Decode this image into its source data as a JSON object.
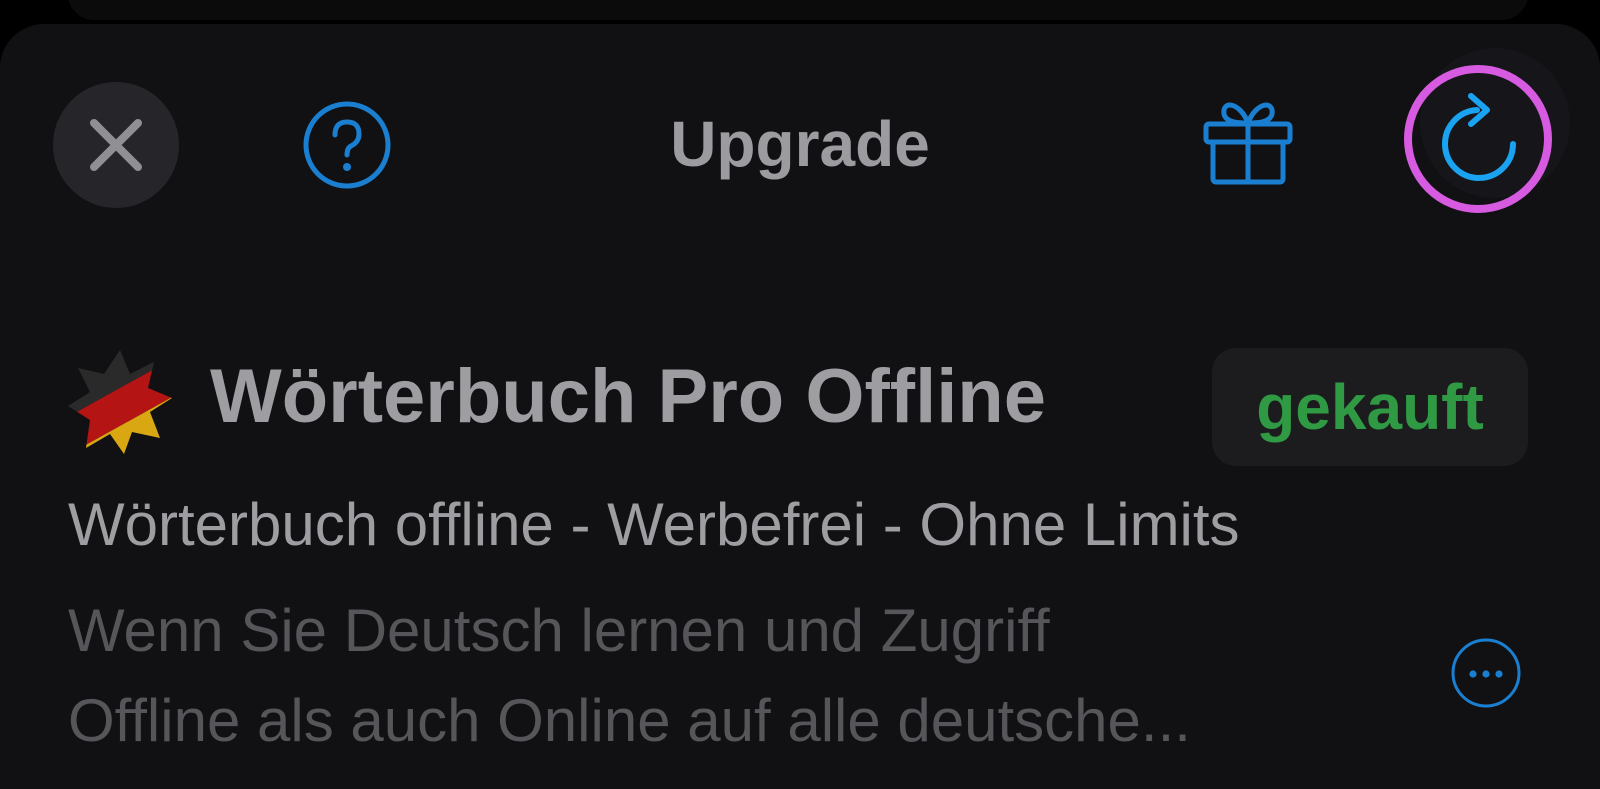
{
  "header": {
    "title": "Upgrade",
    "close_icon": "close-icon",
    "help_icon": "help-icon",
    "gift_icon": "gift-icon",
    "refresh_icon": "refresh-icon"
  },
  "product": {
    "name": "Wörterbuch Pro Offline",
    "status": "gekauft",
    "subtitle": "Wörterbuch offline - Werbefrei - Ohne Limits",
    "description_lines": [
      "Wenn Sie Deutsch lernen und Zugriff",
      "Offline als auch Online auf alle deutsche..."
    ],
    "more_icon": "more-icon"
  },
  "colors": {
    "background": "#111113",
    "accent_blue": "#1a8fe3",
    "highlight_ring": "#d65be0",
    "status_green": "#2f9a43",
    "text_primary": "#9e9ea2",
    "text_secondary": "#55555a"
  }
}
